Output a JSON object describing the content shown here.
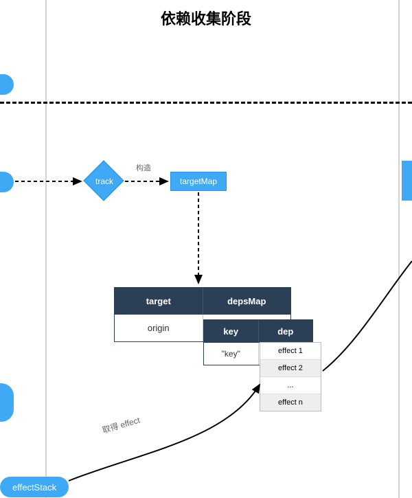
{
  "title": "依赖收集阶段",
  "nodes": {
    "track": "track",
    "targetMap": "targetMap",
    "effectStack": "effectStack"
  },
  "labels": {
    "construct": "构造",
    "getEffect": "取得 effect"
  },
  "tables": {
    "targetTable": {
      "headers": [
        "target",
        "depsMap"
      ],
      "rows": [
        [
          "origin",
          ""
        ]
      ]
    },
    "depsMap": {
      "headers": [
        "key",
        "dep"
      ],
      "rows": [
        [
          "\"key\"",
          ""
        ]
      ]
    },
    "depList": [
      "effect 1",
      "effect 2",
      "...",
      "effect n"
    ]
  }
}
